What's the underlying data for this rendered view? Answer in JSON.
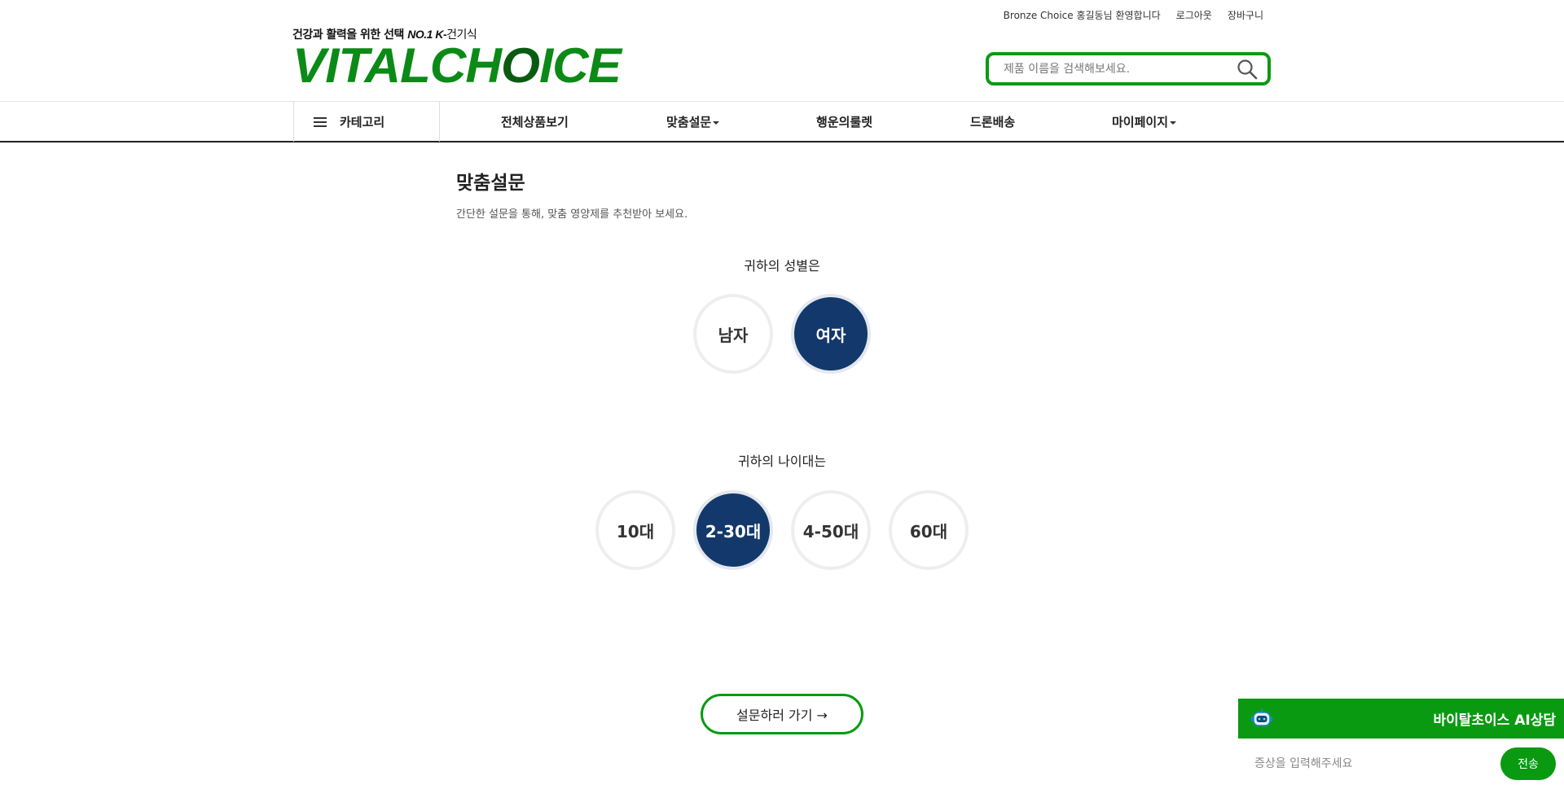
{
  "header": {
    "welcome": "Bronze Choice 홍길동님 환영합니다",
    "logout": "로그아웃",
    "cart": "장바구니",
    "tagline_prefix": "건강과 활력을 위한 선택 ",
    "tagline_no1": "NO.1 K-",
    "tagline_suffix": "건기식",
    "logo_part1": "VITALCH",
    "logo_part2": "O",
    "logo_part3": "ICE",
    "search_placeholder": "제품 이름을 검색해보세요."
  },
  "nav": {
    "category": "카테고리",
    "items": [
      {
        "label": "전체상품보기",
        "has_dropdown": false
      },
      {
        "label": "맞춤설문",
        "has_dropdown": true
      },
      {
        "label": "행운의룰렛",
        "has_dropdown": false
      },
      {
        "label": "드론배송",
        "has_dropdown": false
      },
      {
        "label": "마이페이지",
        "has_dropdown": true
      }
    ]
  },
  "survey": {
    "title": "맞춤설문",
    "subtitle": "간단한 설문을 통해, 맞춤 영양제를 추천받아 보세요.",
    "gender_question": "귀하의 성별은",
    "gender_options": [
      "남자",
      "여자"
    ],
    "gender_selected": "여자",
    "age_question": "귀하의 나이대는",
    "age_options": [
      "10대",
      "2-30대",
      "4-50대",
      "60대"
    ],
    "age_selected": "2-30대",
    "go_button": "설문하러 가기 →"
  },
  "chat": {
    "title": "바이탈초이스 AI상담",
    "input_placeholder": "증상을 입력해주세요",
    "send": "전송"
  },
  "colors": {
    "brand_green": "#0a9a12",
    "selected_navy": "#13386b"
  }
}
